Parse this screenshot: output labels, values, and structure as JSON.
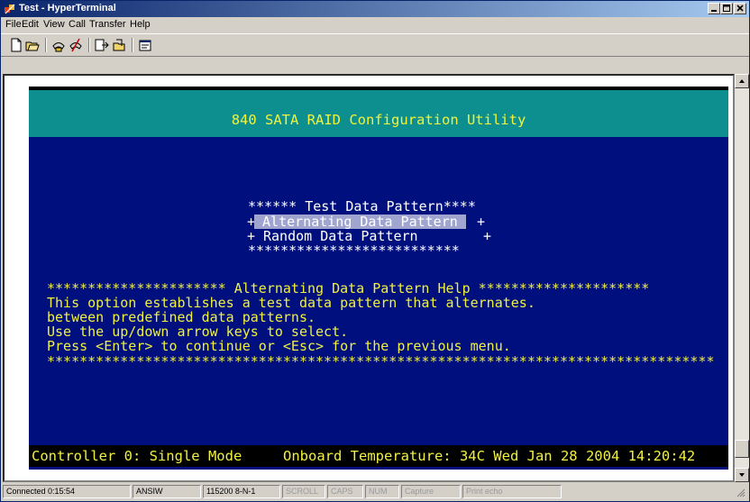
{
  "window": {
    "title": "Test - HyperTerminal"
  },
  "menu": [
    "File",
    "Edit",
    "View",
    "Call",
    "Transfer",
    "Help"
  ],
  "toolbar": {
    "icons": [
      "new-icon",
      "open-icon",
      "connect-icon",
      "disconnect-icon",
      "send-icon",
      "receive-icon",
      "properties-icon"
    ]
  },
  "terminal": {
    "header": "840 SATA RAID Configuration Utility",
    "menu_box": {
      "title": "****** Test Data Pattern****",
      "options": [
        "Alternating Data Pattern",
        "Random Data Pattern"
      ],
      "selected_index": 0,
      "border": "**************************"
    },
    "help": {
      "title": "Alternating Data Pattern Help",
      "lines": [
        "This option establishes a test data pattern that alternates.",
        "between predefined data patterns.",
        "Use the up/down arrow keys to select.",
        "Press <Enter> to continue or <Esc> for the previous menu."
      ]
    },
    "status": {
      "controller": "Controller 0: Single Mode",
      "temperature": "Onboard Temperature: 34C Wed Jan 28 2004 14:20:42"
    }
  },
  "statusbar": [
    "Connected 0:15:54",
    "ANSIW",
    "115200 8-N-1",
    "SCROLL",
    "CAPS",
    "NUM",
    "Capture",
    "Print echo"
  ],
  "colors": {
    "header_band": "#0e8f8f",
    "screen_blue": "#000f7e",
    "text_yellow": "#f0f040",
    "selection": "#9fa5cf"
  }
}
